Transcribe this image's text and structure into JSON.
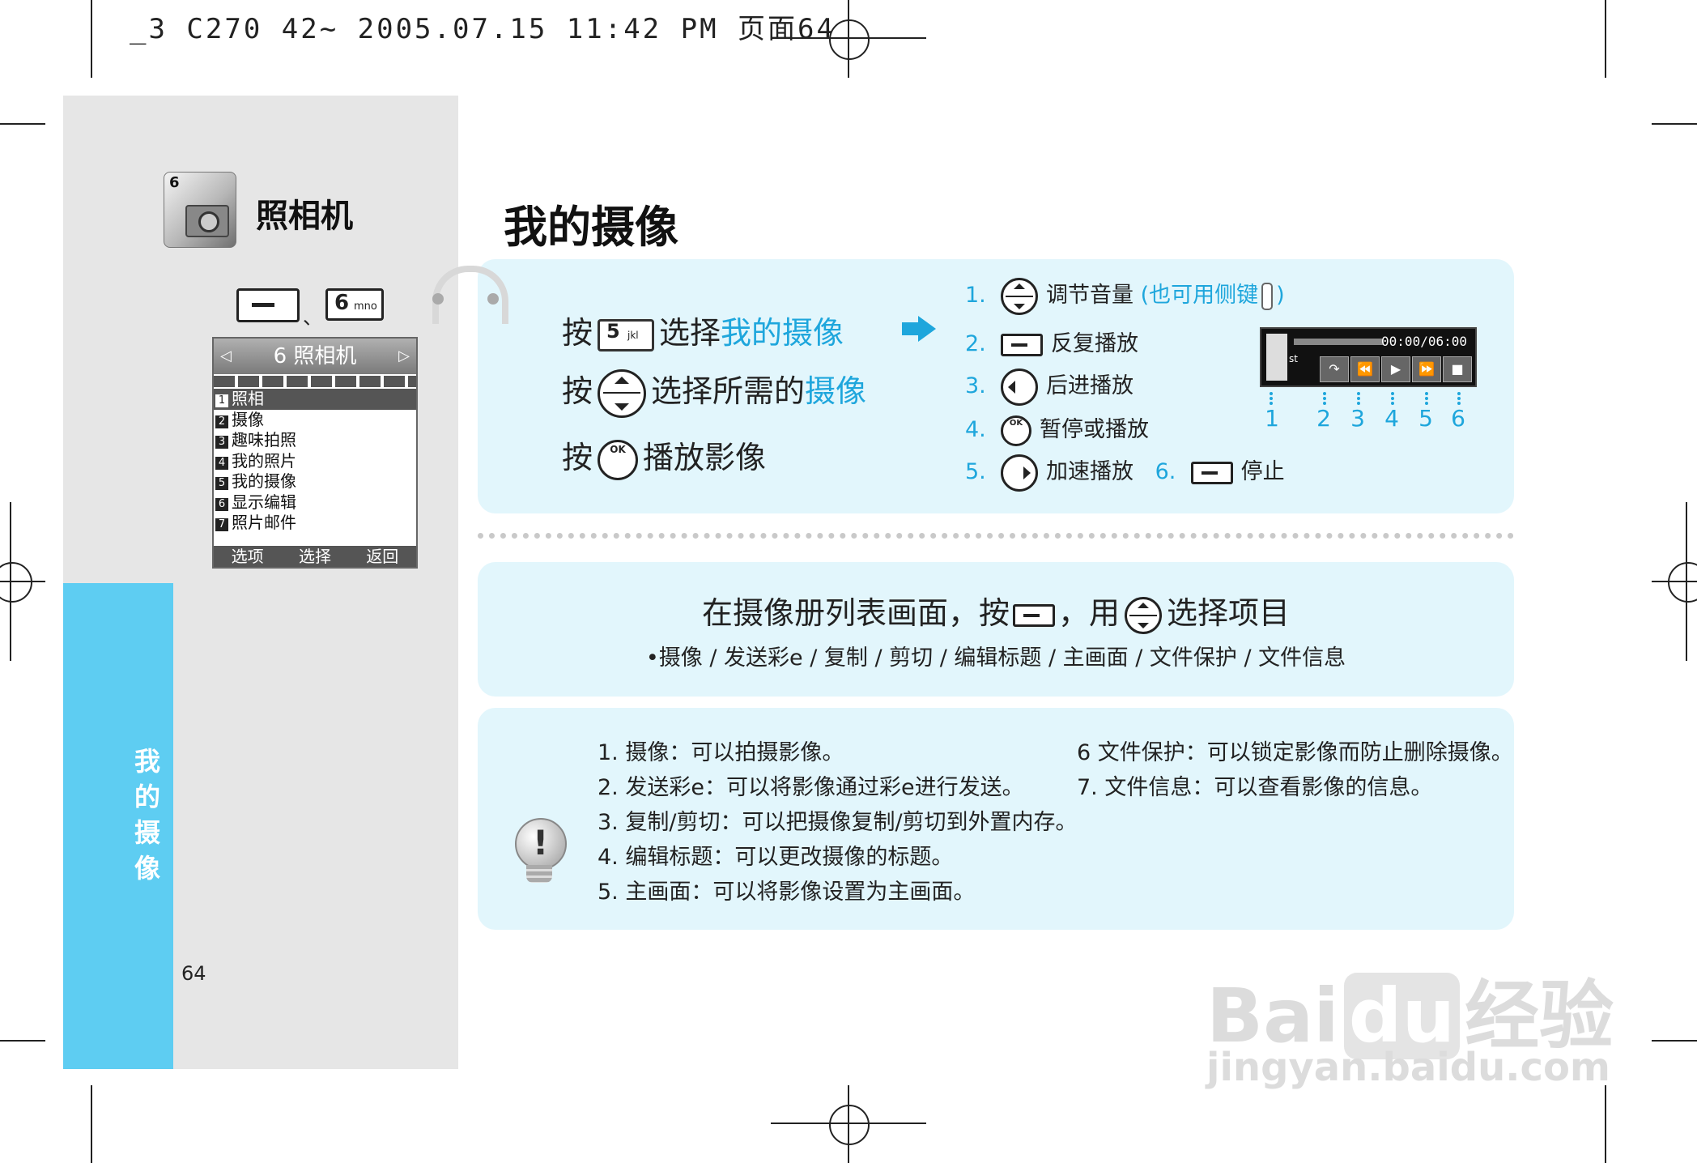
{
  "header": {
    "print_line": "_3 C270 42~ 2005.07.15 11:42 PM 页面64"
  },
  "sidebar": {
    "app_title": "照相机",
    "app_icon_number": "6",
    "key_sep": "、",
    "key6_digit": "6",
    "key6_letters": "mno",
    "vertical_title": [
      "我",
      "的",
      "摄",
      "像"
    ],
    "page_number": "64"
  },
  "phone": {
    "header": "6 照相机",
    "arrow_left": "◁",
    "arrow_right": "▷",
    "items": [
      {
        "num": "1",
        "label": "照相"
      },
      {
        "num": "2",
        "label": "摄像"
      },
      {
        "num": "3",
        "label": "趣味拍照"
      },
      {
        "num": "4",
        "label": "我的照片"
      },
      {
        "num": "5",
        "label": "我的摄像"
      },
      {
        "num": "6",
        "label": "显示编辑"
      },
      {
        "num": "7",
        "label": "照片邮件"
      }
    ],
    "softkeys": [
      "选项",
      "选择",
      "返回"
    ]
  },
  "main": {
    "title": "我的摄像",
    "steps": {
      "s1_pre": "按",
      "s1_key_digit": "5",
      "s1_key_letters": "jkl",
      "s1_text": "选择",
      "s1_hl": "我的摄像",
      "s2_pre": "按",
      "s2_text": "选择所需的",
      "s2_hl": "摄像",
      "s3_pre": "按",
      "s3_text": "播放影像"
    },
    "legend": {
      "l1_num": "1.",
      "l1_text": "调节音量",
      "l1_note_open": "(也可用侧键",
      "l1_note_close": ")",
      "l2_num": "2.",
      "l2_text": "反复播放",
      "l3_num": "3.",
      "l3_text": "后进播放",
      "l4_num": "4.",
      "l4_text": "暂停或播放",
      "l5_num": "5.",
      "l5_text": "加速播放",
      "l6_num": "6.",
      "l6_text": "停止"
    },
    "ok_label": "OK",
    "player": {
      "time": "00:00/06:00",
      "status": "st",
      "buttons": [
        "↷",
        "⏪",
        "▶",
        "⏩",
        "■"
      ],
      "numbers": [
        "1",
        "2",
        "3",
        "4",
        "5",
        "6"
      ]
    },
    "list_box": {
      "main_pre": "在摄像册列表画面，按",
      "main_mid": "，用",
      "main_post": "选择项目",
      "options": "•摄像 / 发送彩e / 复制 / 剪切 / 编辑标题 / 主画面 / 文件保护 / 文件信息"
    },
    "notes_left": [
      "1. 摄像：可以拍摄影像。",
      "2. 发送彩e：可以将影像通过彩e进行发送。",
      "3. 复制/剪切：可以把摄像复制/剪切到外置内存。",
      "4. 编辑标题：可以更改摄像的标题。",
      "5. 主画面：可以将影像设置为主画面。"
    ],
    "notes_right": [
      "6 文件保护：可以锁定影像而防止删除摄像。",
      "7. 文件信息：可以查看影像的信息。"
    ],
    "note_mark": "!"
  },
  "watermark": {
    "brand": "Bai",
    "brand_du": "du",
    "brand_cn": "经验",
    "url": "jingyan.baidu.com"
  },
  "colors": {
    "accent": "#1ea6dc",
    "sidebar_blue": "#5ecdf2",
    "panel_bg": "#e2f6fc",
    "left_bg": "#e6e6e6"
  }
}
